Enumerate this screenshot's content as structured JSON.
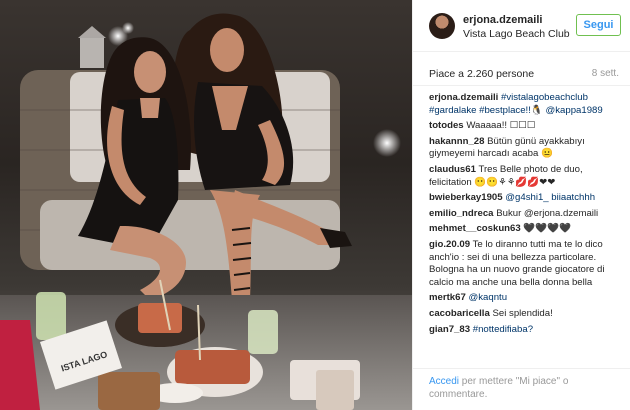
{
  "post": {
    "username": "erjona.dzemaili",
    "location": "Vista Lago Beach Club",
    "follow_label": "Segui",
    "likes": "Piace a 2.260 persone",
    "age": "8 sett.",
    "photo_sign_text": "ISTA LAGO"
  },
  "comments": [
    {
      "user": "erjona.dzemaili",
      "text": "#vistalagobeachclub #gardalake #bestplace!!🐧 @kappa1989"
    },
    {
      "user": "totodes",
      "text": "Waaaaa!! ☐☐☐"
    },
    {
      "user": "hakannn_28",
      "text": "Bütün günü ayakkabıyı giymeyemi harcadı acaba 😐"
    },
    {
      "user": "claudus61",
      "text": "Tres Belle photo de duo, felicitation 😶😶⚘⚘💋💋❤❤"
    },
    {
      "user": "bwieberkay1905",
      "text": "@g4shi1_ biiaatchhh"
    },
    {
      "user": "emilio_ndreca",
      "text": "Bukur @erjona.dzemaili"
    },
    {
      "user": "mehmet__coskun63",
      "text": "🖤🖤🖤🖤"
    },
    {
      "user": "gio.20.09",
      "text": "Te lo diranno tutti ma te lo dico anch'io : sei di una bellezza particolare. Bologna ha un nuovo grande giocatore di calcio ma anche una bella donna bella"
    },
    {
      "user": "mertk67",
      "text": "@kaqntu"
    },
    {
      "user": "cacobaricella",
      "text": "Sei splendida!"
    },
    {
      "user": "gian7_83",
      "text": "#nottedifiaba?"
    }
  ],
  "footer": {
    "login_link": "Accedi",
    "login_text": " per mettere \"Mi piace\" o commentare."
  },
  "colors": {
    "link": "#003569",
    "follow_text": "#3897f0",
    "follow_border": "#70c050",
    "secondary_text": "#999999"
  }
}
